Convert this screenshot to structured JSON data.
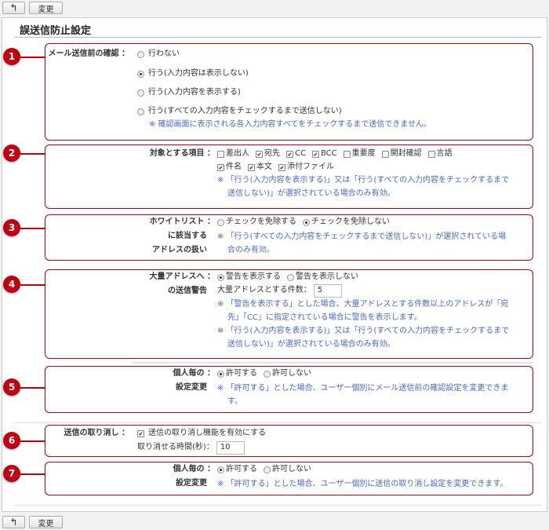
{
  "toolbar": {
    "back_icon": "back-arrow-icon",
    "change_label": "変更"
  },
  "title": "誤送信防止設定",
  "colors": {
    "callout": "#c00010",
    "note": "#4a68d0"
  },
  "s1": {
    "num": "1",
    "label": "メール送信前の確認 ：",
    "options": [
      "行わない",
      "行う(入力内容は表示しない)",
      "行う(入力内容を表示する)",
      "行う(すべての入力内容をチェックするまで送信しない)"
    ],
    "selected": 1,
    "note": "※ 確認画面に表示される各入力内容すべてをチェックするまで送信できません。"
  },
  "s2": {
    "num": "2",
    "label": "対象とする項目 ：",
    "items": [
      {
        "label": "差出人",
        "checked": false
      },
      {
        "label": "宛先",
        "checked": true
      },
      {
        "label": "CC",
        "checked": true
      },
      {
        "label": "BCC",
        "checked": true
      },
      {
        "label": "重要度",
        "checked": false
      },
      {
        "label": "開封確認",
        "checked": false
      },
      {
        "label": "言語",
        "checked": false
      },
      {
        "label": "件名",
        "checked": true
      },
      {
        "label": "本文",
        "checked": true
      },
      {
        "label": "添付ファイル",
        "checked": true
      }
    ],
    "note1": "※ 「行う(入力内容を表示する)」又は「行う(すべての入力内容をチェックするまで",
    "note2": "送信しない)」が選択されている場合のみ有効。"
  },
  "s3": {
    "num": "3",
    "label1": "ホワイトリスト ：",
    "label2": "に該当する",
    "label3": "アドレスの扱い",
    "options": [
      "チェックを免除する",
      "チェックを免除しない"
    ],
    "selected": 1,
    "note1": "※ 「行う(すべての入力内容をチェックするまで送信しない)」が選択されている場",
    "note2": "合のみ有効。"
  },
  "s4": {
    "num": "4",
    "label1": "大量アドレスへ ：",
    "label2": "の送信警告",
    "options": [
      "警告を表示する",
      "警告を表示しない"
    ],
    "selected": 0,
    "count_label": "大量アドレスとする件数：",
    "count_value": "5",
    "note1": "※ 「警告を表示する」とした場合、大量アドレスとする件数以上のアドレスが「宛",
    "note2": "先」「CC」に指定されている場合に警告を表示します。",
    "note3": "※ 「行う(入力内容を表示する)」又は「行う(すべての入力内容をチェックするまで",
    "note4": "送信しない)」が選択されている場合のみ有効。"
  },
  "s5": {
    "num": "5",
    "label1": "個人毎の ：",
    "label2": "設定変更",
    "options": [
      "許可する",
      "許可しない"
    ],
    "selected": 0,
    "note1": "※ 「許可する」とした場合、ユーザー個別にメール送信前の確認設定を変更できま",
    "note2": "す。"
  },
  "s6": {
    "num": "6",
    "label": "送信の取り消し ：",
    "checkbox_label": "送信の取り消し機能を有効にする",
    "checked": true,
    "time_label": "取り消せる時間(秒)：",
    "time_value": "10"
  },
  "s7": {
    "num": "7",
    "label1": "個人毎の ：",
    "label2": "設定変更",
    "options": [
      "許可する",
      "許可しない"
    ],
    "selected": 0,
    "note": "※ 「許可する」とした場合、ユーザー個別に送信の取り消し設定を変更できます。"
  }
}
